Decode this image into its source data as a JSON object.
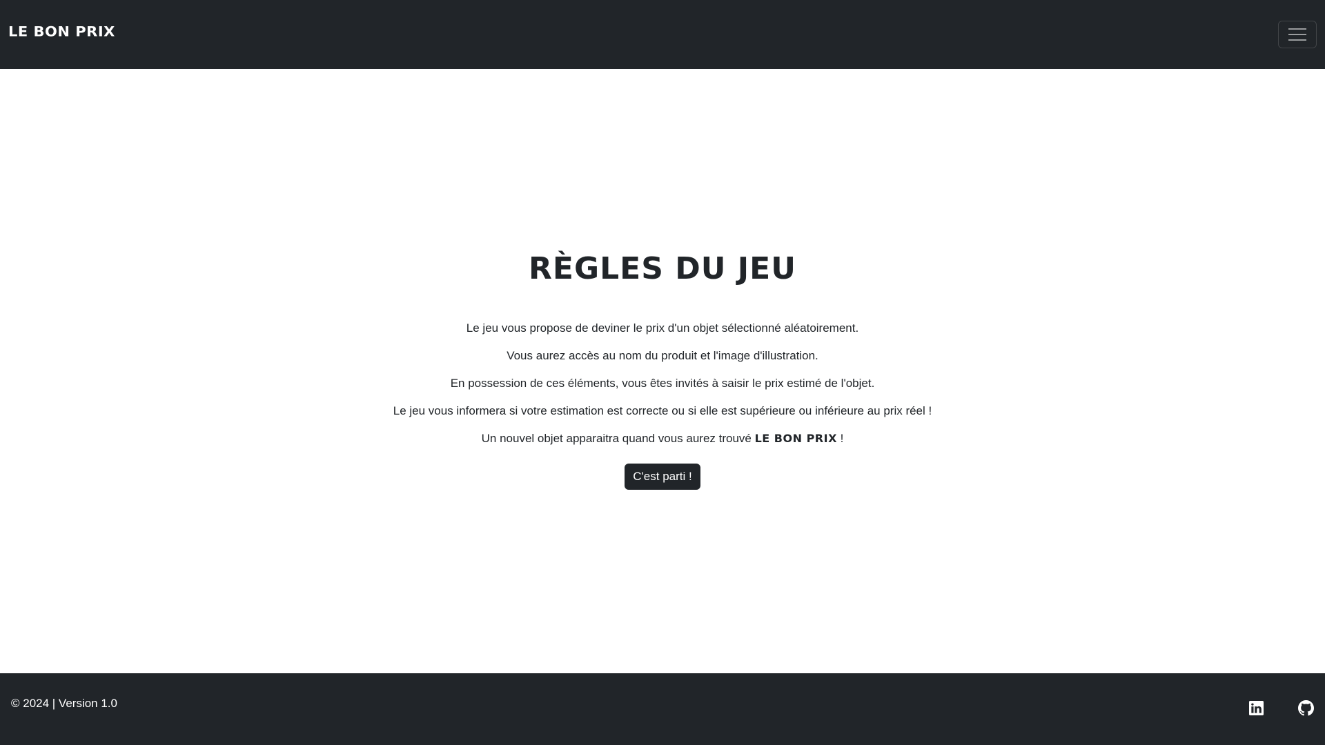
{
  "navbar": {
    "brand": "Le Bon Prix",
    "menu_icon": "hamburger-menu-icon"
  },
  "main": {
    "title": "Règles du jeu",
    "rules": [
      "Le jeu vous propose de deviner le prix d'un objet sélectionné aléatoirement.",
      "Vous aurez accès au nom du produit et l'image d'illustration.",
      "En possession de ces éléments, vous êtes invités à saisir le prix estimé de l'objet.",
      "Le jeu vous informera si votre estimation est correcte ou si elle est supérieure ou inférieure au prix réel !"
    ],
    "last_rule": {
      "before": "Un nouvel objet apparaitra quand vous aurez trouvé ",
      "brand": "Le Bon Prix",
      "after": " !"
    },
    "start_button": "C'est parti !"
  },
  "footer": {
    "copyright": "© 2024 | Version 1.0",
    "icons": [
      "linkedin-icon",
      "github-icon"
    ]
  },
  "colors": {
    "dark": "#212529",
    "light": "#ffffff"
  }
}
